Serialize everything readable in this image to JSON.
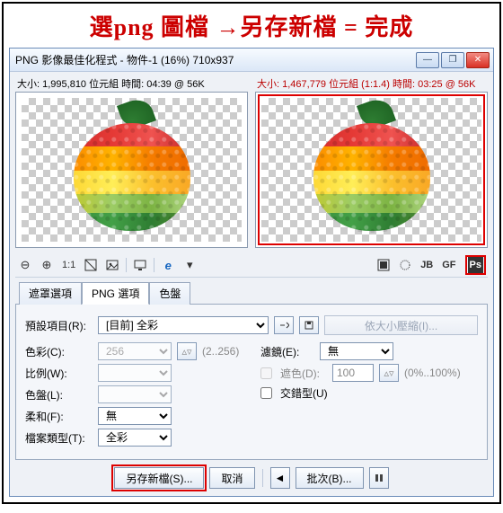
{
  "instruction": "選png 圖檔 →另存新檔 = 完成",
  "window": {
    "title": "PNG 影像最佳化程式 - 物件-1 (16%) 710x937",
    "minimize": "—",
    "maximize": "❐",
    "close": "✕"
  },
  "preview": {
    "left_header": "大小: 1,995,810 位元組 時間: 04:39 @ 56K",
    "right_header": "大小: 1,467,779 位元組 (1:1.4) 時間: 03:25 @ 56K"
  },
  "toolbar": {
    "zoom_out": "⊖",
    "zoom_in": "⊕",
    "one_to_one": "1:1",
    "ie": "e",
    "right_ps": "Ps",
    "right_jb": "JB",
    "right_gf": "GF"
  },
  "tabs": {
    "mask": "遮罩選項",
    "png": "PNG 選項",
    "palette": "色盤"
  },
  "form": {
    "preset_label": "預設項目(R):",
    "preset_value": "[目前] 全彩",
    "compress_placeholder": "依大小壓縮(I)...",
    "colors_label": "色彩(C):",
    "colors_value": "256",
    "colors_range": "(2..256)",
    "ratio_label": "比例(W):",
    "palette_label": "色盤(L):",
    "soft_label": "柔和(F):",
    "soft_value": "無",
    "filetype_label": "檔案類型(T):",
    "filetype_value": "全彩",
    "filter_label": "濾鏡(E):",
    "filter_value": "無",
    "mask_label": "遮色(D):",
    "mask_value": "100",
    "mask_range": "(0%..100%)",
    "interlace_label": "交錯型(U)"
  },
  "footer": {
    "save_as": "另存新檔(S)...",
    "cancel": "取消",
    "batch": "批次(B)...",
    "arrow_left": "◄",
    "arrow_right": "►"
  }
}
